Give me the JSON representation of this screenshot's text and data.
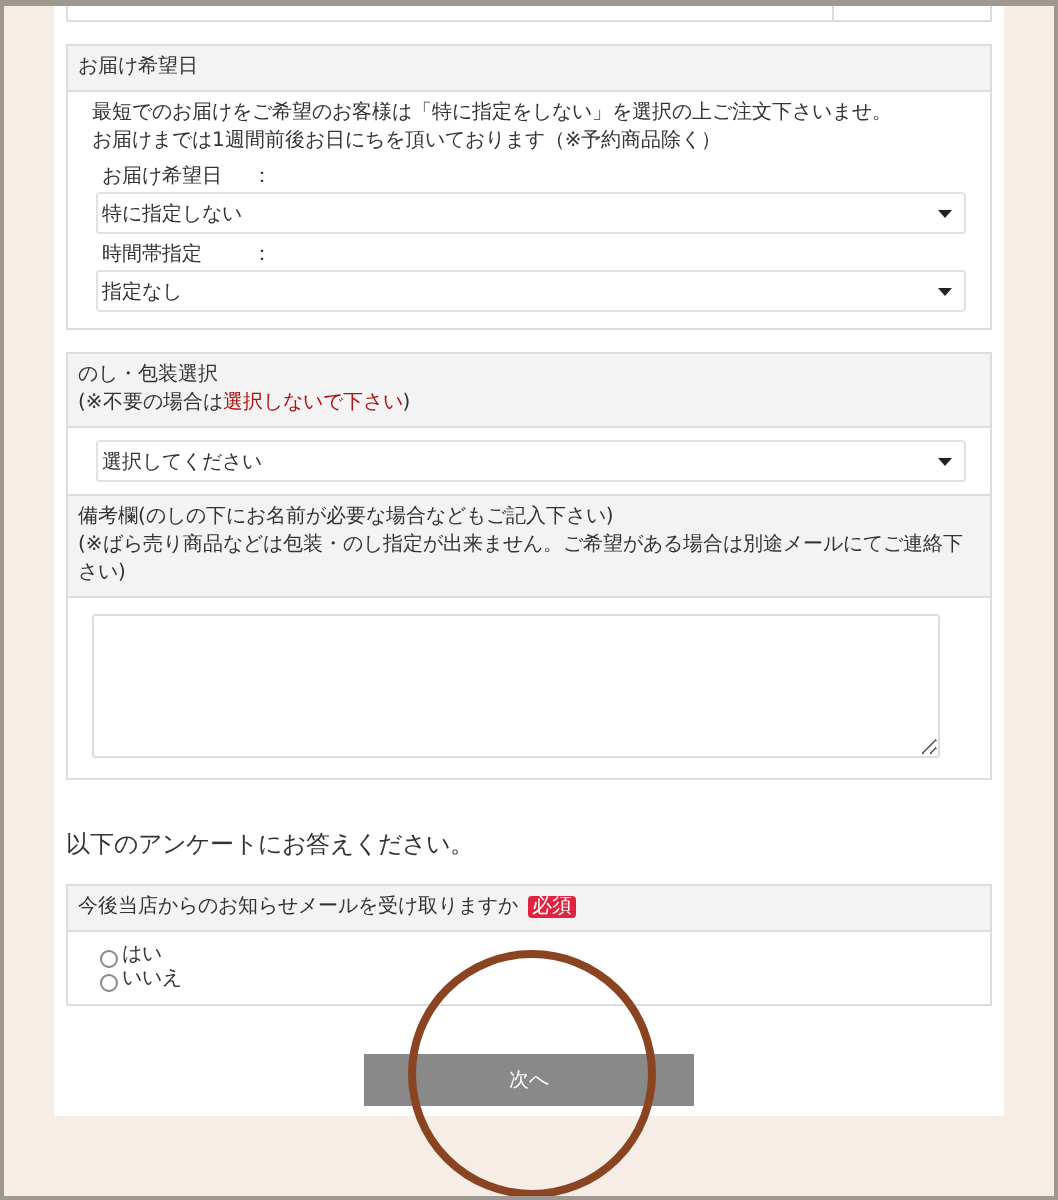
{
  "delivery": {
    "title": "お届け希望日",
    "notes": [
      "最短でのお届けをご希望のお客様は「特に指定をしない」を選択の上ご注文下さいませ。",
      "お届けまでは1週間前後お日にちを頂いております（※予約商品除く）"
    ],
    "fields": [
      {
        "label": "お届け希望日",
        "colon": "：",
        "value": "特に指定しない"
      },
      {
        "label": "時間帯指定",
        "colon": "：",
        "value": "指定なし"
      }
    ]
  },
  "noshi": {
    "title": "のし・包装選択",
    "note": "(※不要の場合は**選択しないで下さい**)",
    "value": "選択してください"
  },
  "remarks": {
    "title": "備考欄(のしの下にお名前が必要な場合などもご記入下さい)",
    "note": "(※ばら売り商品などは包装・のし指定が出来ません。ご希望がある場合は別途メールにてご連絡下さい)"
  },
  "survey": {
    "heading": "以下のアンケートにお答えください。",
    "question": "今後当店からのお知らせメールを受け取りますか",
    "badge": "必須",
    "options": [
      {
        "label": "はい",
        "selected": false
      },
      {
        "label": "いいえ",
        "selected": false
      }
    ]
  },
  "next_button": "次へ"
}
